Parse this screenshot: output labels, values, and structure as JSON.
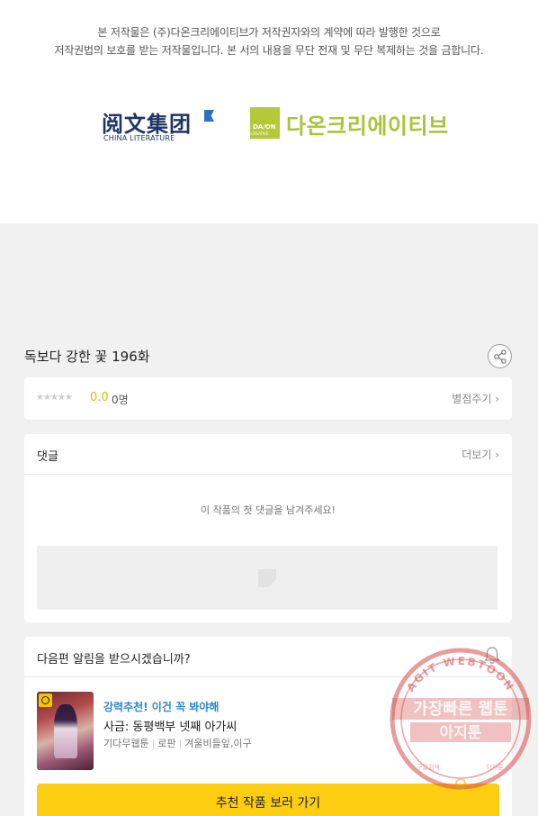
{
  "copyright": {
    "line1": "본 저작물은 (주)다온크리에이티브가 저작권자와의 계약에 따라 발행한 것으로",
    "line2": "저작권법의 보호를 받는 저작물입니다. 본 서의 내용을 무단 전재 및 무단 복제하는 것을 금합니다.",
    "logo_china_literature": {
      "cn": "阅文集团",
      "en": "CHINA LITERATURE"
    },
    "logo_daon": {
      "badge": "DA/ON",
      "badge_sub": "CREATIVE",
      "text": "다온크리에이티브"
    }
  },
  "episode": {
    "title": "독보다 강한 꽃 196화",
    "share_icon": "share-icon"
  },
  "rating": {
    "stars": "★★★★★",
    "score": "0.0",
    "count": "0명",
    "rate_link": "별점주기 ›"
  },
  "comments": {
    "title": "댓글",
    "more": "더보기 ›",
    "empty_message": "이 작품의 첫 댓글을 남겨주세요!"
  },
  "notify": {
    "question": "다음편 알림을 받으시겠습니까?",
    "bell_icon": "bell-icon"
  },
  "recommendation": {
    "tag": "강력추천! 이건 꼭 봐야해",
    "title": "사금: 동평백부 넷째 아가씨",
    "genre": "기다무웹툰",
    "category": "로판",
    "author": "겨울비들잎,이구",
    "button": "추천 작품 보러 가기"
  },
  "watermark": {
    "arc_top": "AGIT WEBTOON",
    "line1": "가장빠른 웹툰",
    "line2": "아지툰",
    "arc_bottom_left": "구글검색",
    "arc_bottom_right": "아지툰"
  },
  "colors": {
    "accent_yellow": "#fdcd12",
    "score_yellow": "#e6b800",
    "tag_blue": "#2a86d4",
    "stamp_red": "#d64a4a"
  }
}
